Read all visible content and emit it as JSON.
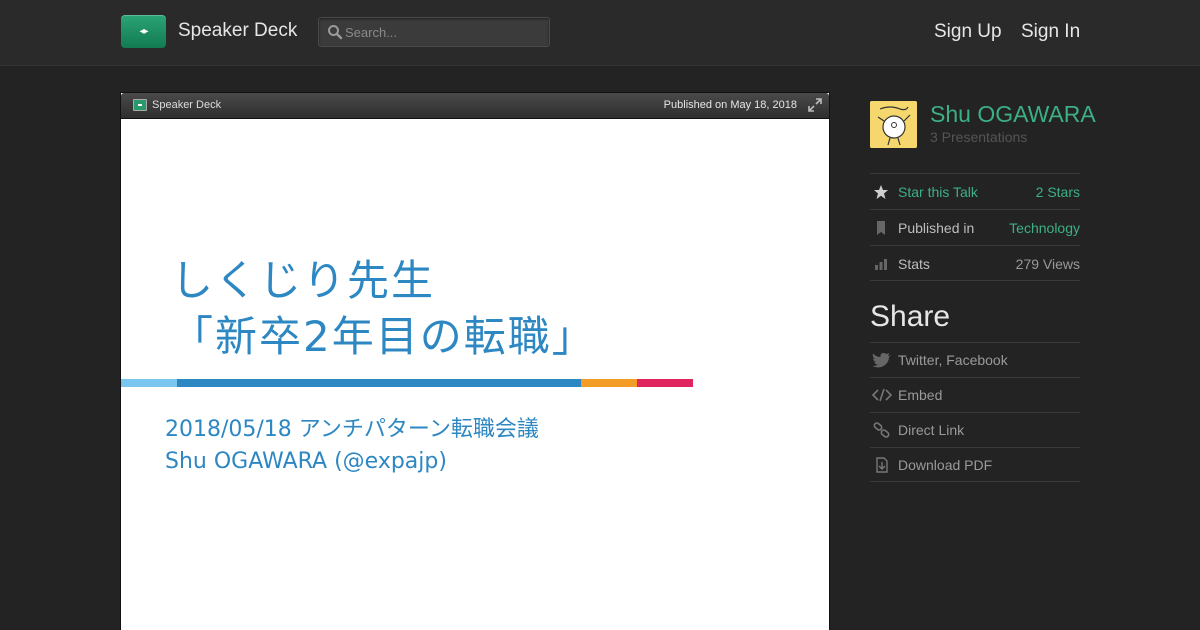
{
  "header": {
    "brand": "Speaker Deck",
    "search_placeholder": "Search...",
    "sign_up": "Sign Up",
    "sign_in": "Sign In"
  },
  "player": {
    "bar_brand": "Speaker Deck",
    "published": "Published on May 18, 2018"
  },
  "slide": {
    "title_line1": "しくじり先生",
    "title_line2": "「新卒2年目の転職」",
    "subtitle_line1": "2018/05/18 アンチパターン転職会議",
    "subtitle_line2": "Shu OGAWARA (@expajp)",
    "stripe_colors": [
      "#7bc6ee",
      "#2d87c2",
      "#f39c26",
      "#e0245e"
    ]
  },
  "author": {
    "name": "Shu OGAWARA",
    "presentations": "3 Presentations"
  },
  "meta": {
    "star_label": "Star this Talk",
    "star_value": "2 Stars",
    "published_label": "Published in",
    "published_value": "Technology",
    "stats_label": "Stats",
    "stats_value": "279 Views"
  },
  "share": {
    "heading": "Share",
    "items": [
      "Twitter, Facebook",
      "Embed",
      "Direct Link",
      "Download PDF"
    ]
  },
  "colors": {
    "accent": "#3cb085",
    "background": "#232323",
    "slide_text": "#2d87c2"
  }
}
